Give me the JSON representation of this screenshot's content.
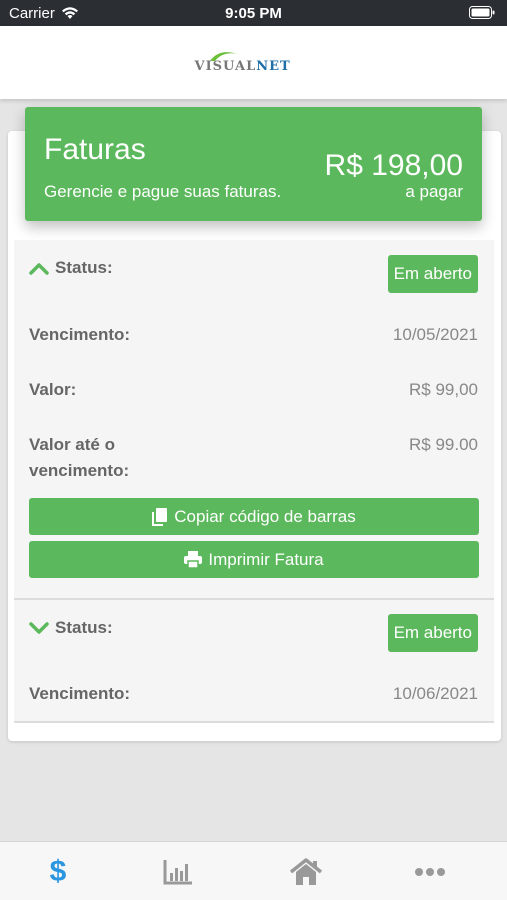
{
  "status_bar": {
    "carrier": "Carrier",
    "time": "9:05 PM"
  },
  "header": {
    "logo_part1": "VISUAL",
    "logo_part2": "NET"
  },
  "banner": {
    "title": "Faturas",
    "subtitle": "Gerencie e pague suas faturas.",
    "amount": "R$ 198,00",
    "amount_label": "a pagar"
  },
  "invoices": [
    {
      "status_label": "Status:",
      "status_value": "Em aberto",
      "due_label": "Vencimento:",
      "due_value": "10/05/2021",
      "value_label": "Valor:",
      "value_value": "R$ 99,00",
      "value_due_label_line1": "Valor até o",
      "value_due_label_line2": "vencimento:",
      "value_due_value": "R$ 99.00",
      "copy_button": "Copiar código de barras",
      "print_button": "Imprimir Fatura",
      "expanded": true
    },
    {
      "status_label": "Status:",
      "status_value": "Em aberto",
      "due_label": "Vencimento:",
      "due_value": "10/06/2021",
      "expanded": false
    }
  ],
  "nav": {
    "items": [
      "dollar-icon",
      "chart-icon",
      "home-icon",
      "more-icon"
    ],
    "active": "dollar-icon",
    "dollar_symbol": "$"
  },
  "colors": {
    "accent_green": "#5cb85c",
    "active_blue": "#2b95e0"
  }
}
